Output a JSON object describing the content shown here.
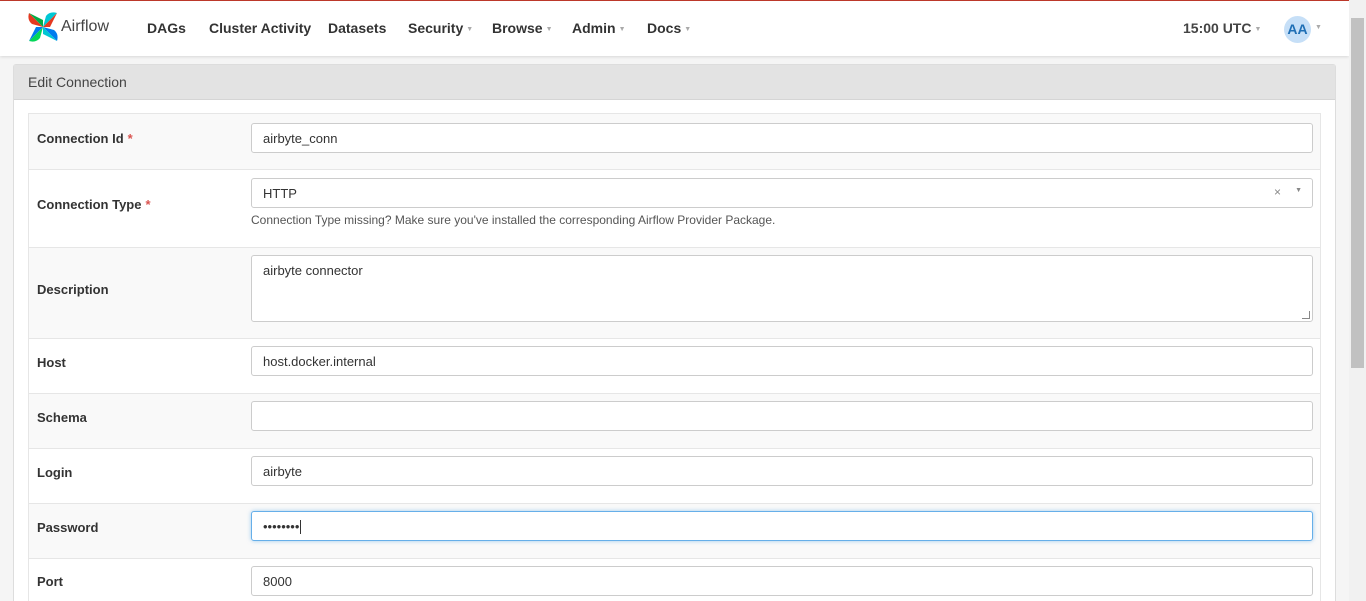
{
  "app": {
    "brand": "Airflow",
    "brand_colors": [
      "#e43921",
      "#00c7d4",
      "#017cee",
      "#04d659"
    ]
  },
  "nav": {
    "items": [
      {
        "label": "DAGs",
        "dropdown": false
      },
      {
        "label": "Cluster Activity",
        "dropdown": false
      },
      {
        "label": "Datasets",
        "dropdown": false
      },
      {
        "label": "Security",
        "dropdown": true
      },
      {
        "label": "Browse",
        "dropdown": true
      },
      {
        "label": "Admin",
        "dropdown": true
      },
      {
        "label": "Docs",
        "dropdown": true
      }
    ],
    "time": "15:00 UTC",
    "user_initials": "AA"
  },
  "form": {
    "title": "Edit Connection",
    "required_marker": "*",
    "fields": {
      "conn_id": {
        "label": "Connection Id",
        "value": "airbyte_conn",
        "required": true
      },
      "conn_type": {
        "label": "Connection Type",
        "value": "HTTP",
        "required": true,
        "clear": "×",
        "help": "Connection Type missing? Make sure you've installed the corresponding Airflow Provider Package."
      },
      "description": {
        "label": "Description",
        "value": "airbyte connector"
      },
      "host": {
        "label": "Host",
        "value": "host.docker.internal"
      },
      "schema": {
        "label": "Schema",
        "value": ""
      },
      "login": {
        "label": "Login",
        "value": "airbyte"
      },
      "password": {
        "label": "Password",
        "value": "••••••••",
        "focused": true
      },
      "port": {
        "label": "Port",
        "value": "8000"
      }
    }
  }
}
